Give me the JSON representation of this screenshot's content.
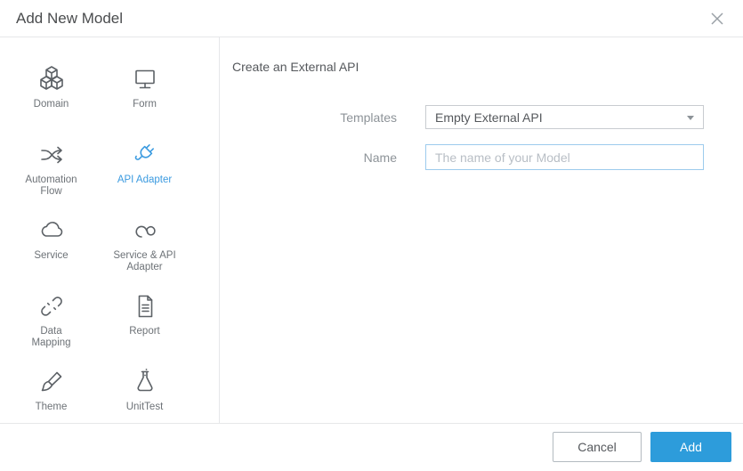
{
  "header": {
    "title": "Add New Model"
  },
  "sidebar": {
    "items": [
      {
        "label": "Domain",
        "icon": "cubes-icon",
        "selected": false
      },
      {
        "label": "Form",
        "icon": "monitor-icon",
        "selected": false
      },
      {
        "label": "Automation Flow",
        "icon": "shuffle-icon",
        "selected": false
      },
      {
        "label": "API Adapter",
        "icon": "plug-icon",
        "selected": true
      },
      {
        "label": "Service",
        "icon": "cloud-icon",
        "selected": false
      },
      {
        "label": "Service & API Adapter",
        "icon": "cloud-loop-icon",
        "selected": false
      },
      {
        "label": "Data Mapping",
        "icon": "broken-link-icon",
        "selected": false
      },
      {
        "label": "Report",
        "icon": "report-icon",
        "selected": false
      },
      {
        "label": "Theme",
        "icon": "paintbrush-icon",
        "selected": false
      },
      {
        "label": "UnitTest",
        "icon": "flask-icon",
        "selected": false
      }
    ]
  },
  "main": {
    "heading": "Create an External API",
    "form": {
      "templates_label": "Templates",
      "templates_value": "Empty External API",
      "name_label": "Name",
      "name_value": "",
      "name_placeholder": "The name of your Model"
    }
  },
  "footer": {
    "cancel_label": "Cancel",
    "add_label": "Add"
  },
  "colors": {
    "accent_blue": "#2d9cdb",
    "selected_blue": "#3c9be0",
    "input_focus_border": "#9dcbed",
    "divider": "#e6e7e9"
  }
}
